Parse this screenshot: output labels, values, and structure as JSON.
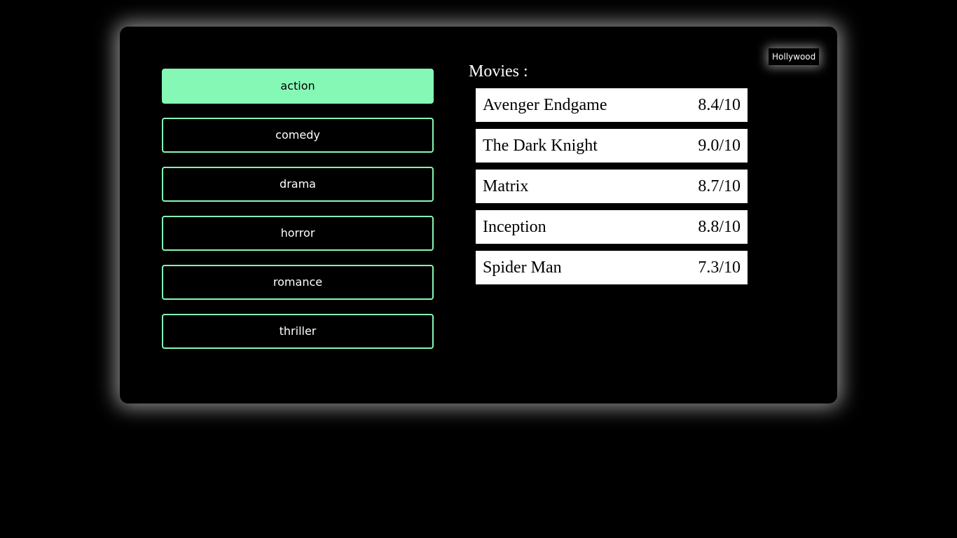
{
  "region": {
    "label": "Hollywood"
  },
  "genres": [
    {
      "label": "action",
      "active": true
    },
    {
      "label": "comedy",
      "active": false
    },
    {
      "label": "drama",
      "active": false
    },
    {
      "label": "horror",
      "active": false
    },
    {
      "label": "romance",
      "active": false
    },
    {
      "label": "thriller",
      "active": false
    }
  ],
  "movies_section": {
    "title": "Movies :",
    "items": [
      {
        "name": "Avenger Endgame",
        "rating": "8.4/10"
      },
      {
        "name": "The Dark Knight",
        "rating": "9.0/10"
      },
      {
        "name": "Matrix",
        "rating": "8.7/10"
      },
      {
        "name": "Inception",
        "rating": "8.8/10"
      },
      {
        "name": "Spider Man",
        "rating": "7.3/10"
      }
    ]
  },
  "colors": {
    "accent": "#86f8b6",
    "background": "#000000",
    "row_bg": "#ffffff"
  }
}
